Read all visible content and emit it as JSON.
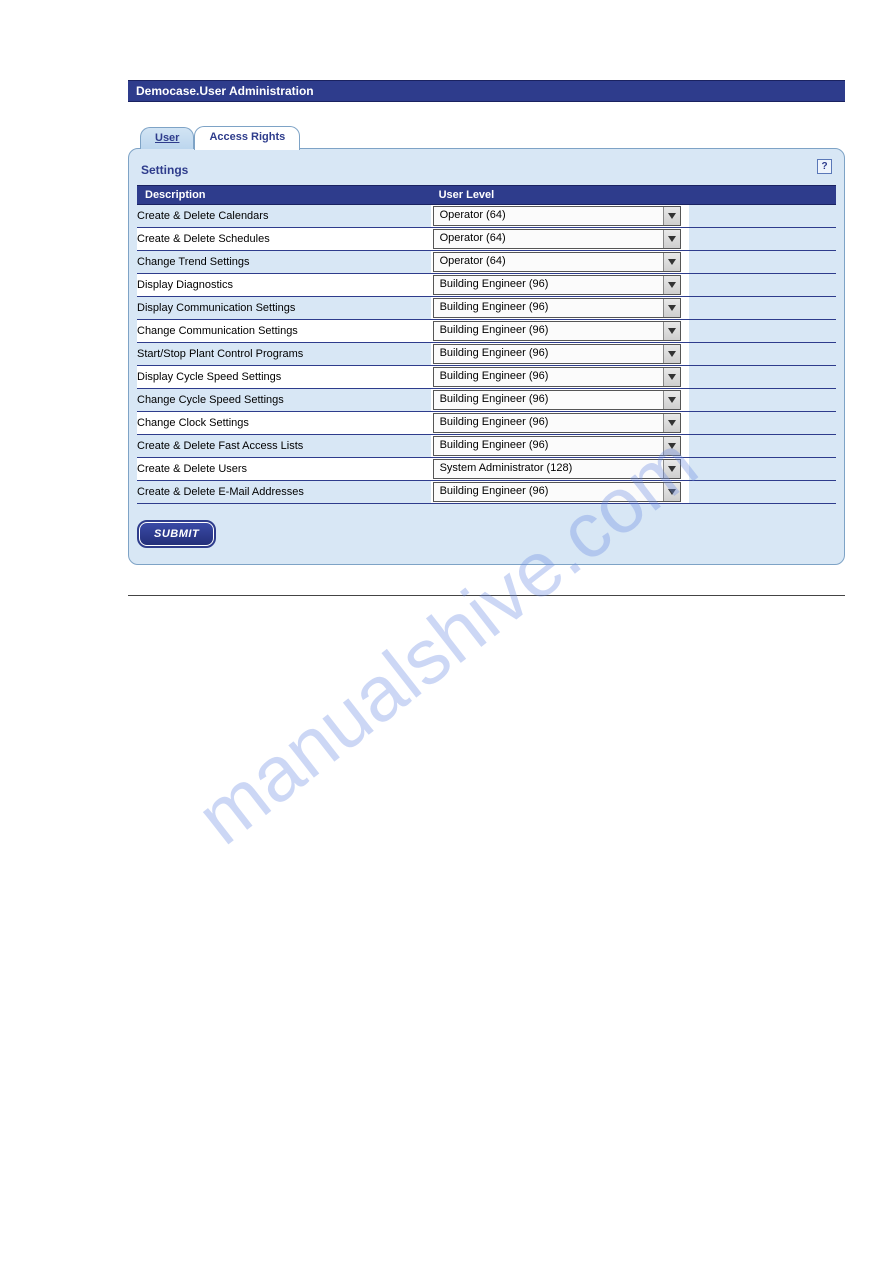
{
  "titleBar": "Democase.User Administration",
  "tabs": {
    "user": "User",
    "accessRights": "Access Rights"
  },
  "panelTitle": "Settings",
  "helpIcon": "?",
  "columns": {
    "description": "Description",
    "userLevel": "User Level"
  },
  "rows": [
    {
      "description": "Create & Delete Calendars",
      "level": "Operator (64)"
    },
    {
      "description": "Create & Delete Schedules",
      "level": "Operator (64)"
    },
    {
      "description": "Change Trend Settings",
      "level": "Operator (64)"
    },
    {
      "description": "Display Diagnostics",
      "level": "Building Engineer (96)"
    },
    {
      "description": "Display Communication Settings",
      "level": "Building Engineer (96)"
    },
    {
      "description": "Change Communication Settings",
      "level": "Building Engineer (96)"
    },
    {
      "description": "Start/Stop Plant Control Programs",
      "level": "Building Engineer (96)"
    },
    {
      "description": "Display Cycle Speed Settings",
      "level": "Building Engineer (96)"
    },
    {
      "description": "Change Cycle Speed Settings",
      "level": "Building Engineer (96)"
    },
    {
      "description": "Change Clock Settings",
      "level": "Building Engineer (96)"
    },
    {
      "description": "Create & Delete Fast Access Lists",
      "level": "Building Engineer (96)"
    },
    {
      "description": "Create & Delete Users",
      "level": "System Administrator (128)"
    },
    {
      "description": "Create & Delete E-Mail Addresses",
      "level": "Building Engineer (96)"
    }
  ],
  "submitLabel": "SUBMIT",
  "watermark": "manualshive.com"
}
